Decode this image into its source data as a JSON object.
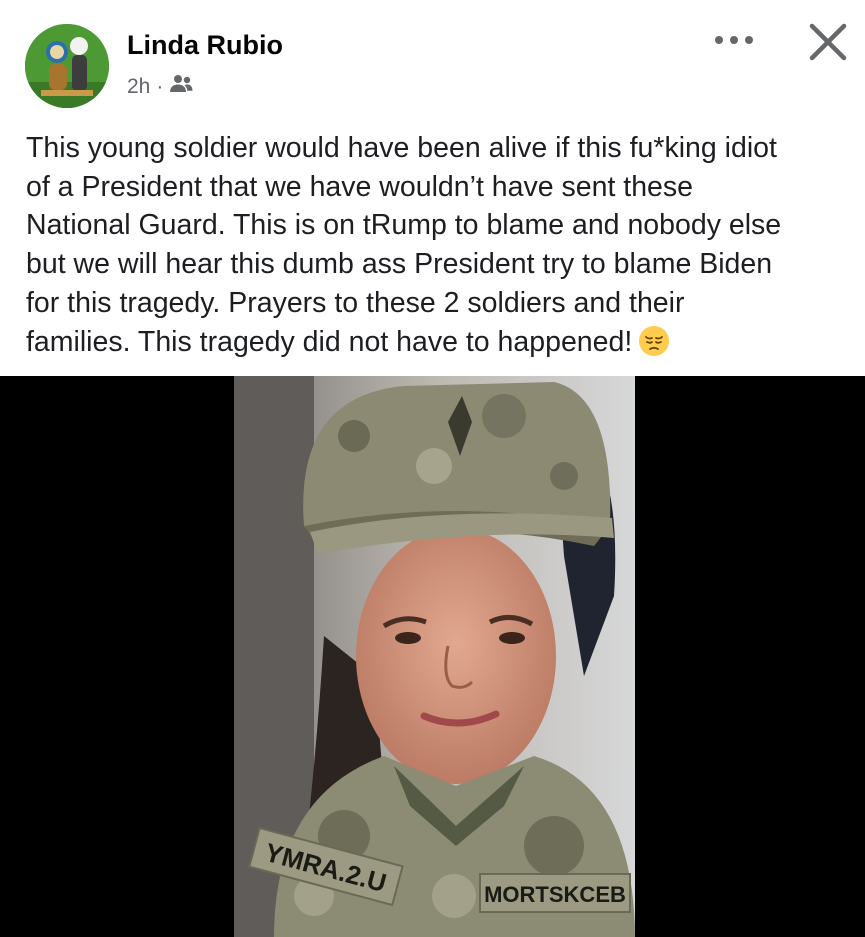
{
  "post": {
    "author": "Linda Rubio",
    "time": "2h",
    "audience_icon": "friends-icon",
    "more_icon": "more-dots-icon",
    "close_icon": "close-icon",
    "text_lines": [
      "This young soldier would have been alive if this fu*king idiot",
      "of a President that we have wouldn’t have sent these",
      "National Guard.  This is on tRump to blame and nobody else",
      "but we will hear this dumb ass President try to blame Biden",
      "for this tragedy.  Prayers to these 2 soldiers and their",
      "families.  This tragedy did not have to happened!"
    ],
    "emoji": "pensive-face-emoji"
  },
  "photo": {
    "name_tape_left": "YMRA.2.U",
    "name_tape_right": "MORTSKCEB"
  },
  "colors": {
    "text": "#1c1e21",
    "secondary": "#65676b",
    "media_bg": "#000000"
  }
}
